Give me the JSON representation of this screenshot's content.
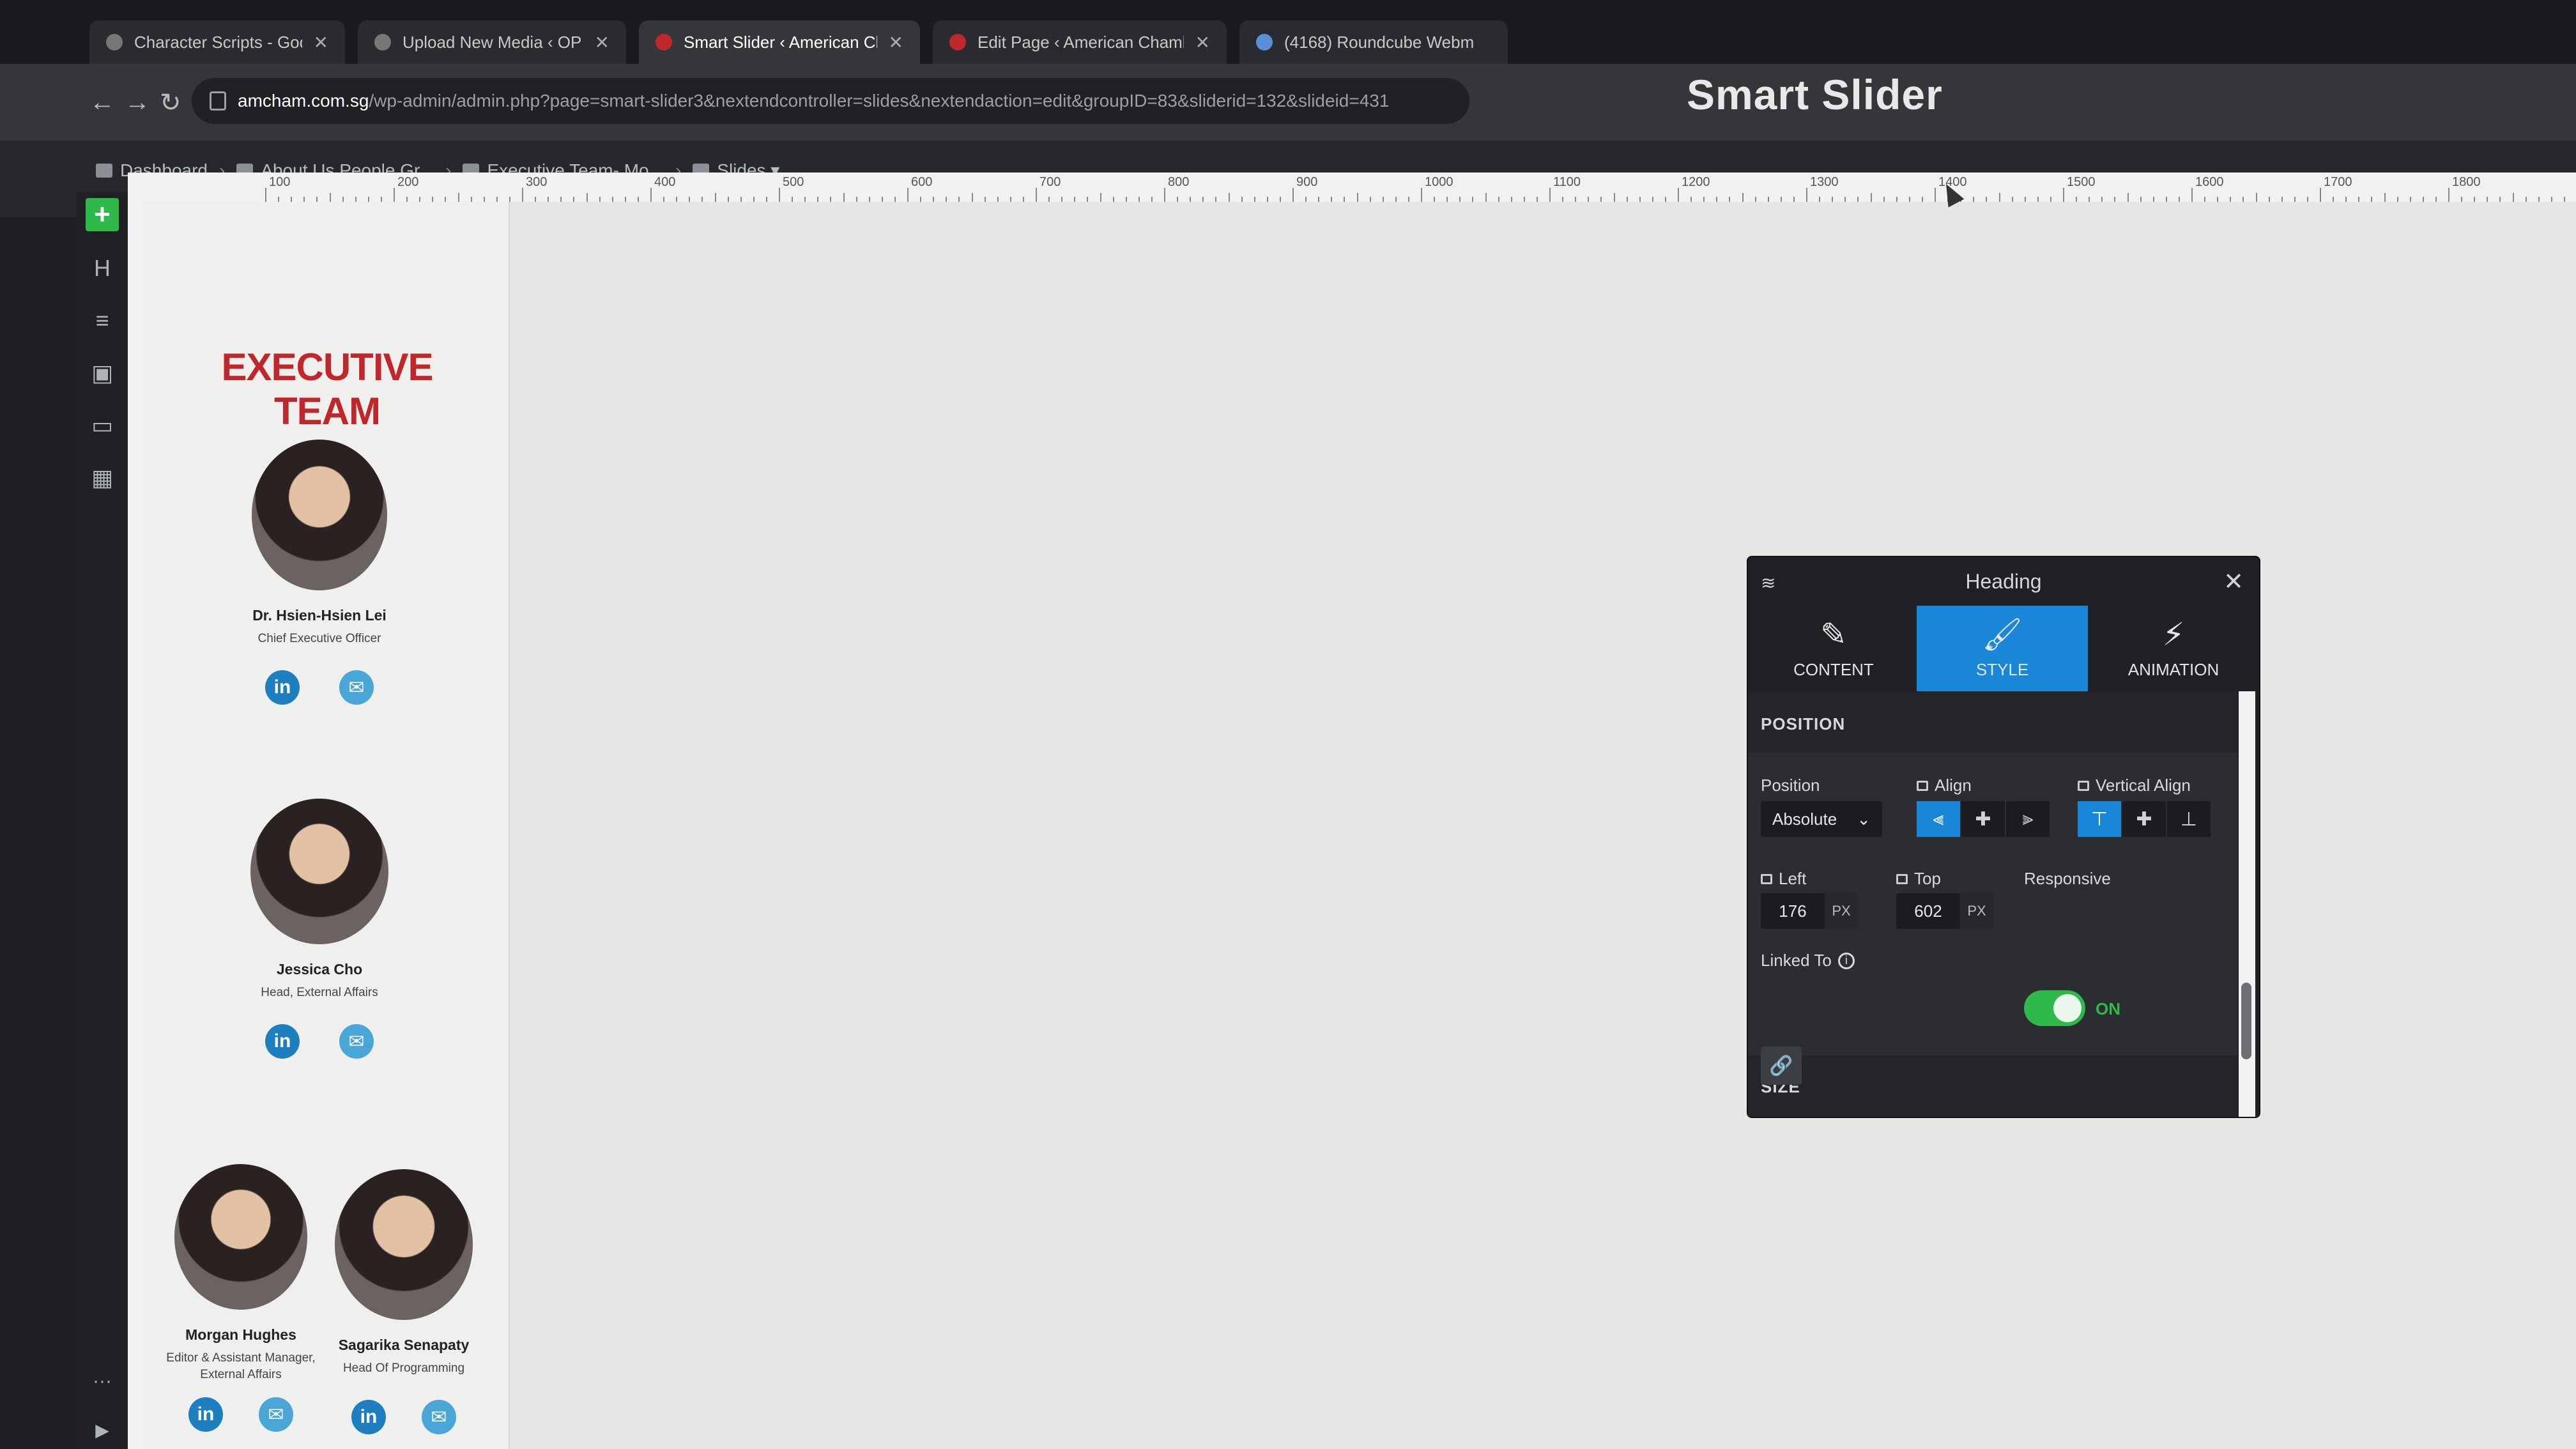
{
  "browser": {
    "tabs": [
      {
        "label": "Character Scripts - Google Dr",
        "active": false
      },
      {
        "label": "Upload New Media ‹ OP Demo",
        "active": false
      },
      {
        "label": "Smart Slider ‹ American Cham",
        "active": true
      },
      {
        "label": "Edit Page ‹ American Chamber",
        "active": false
      },
      {
        "label": "(4168) Roundcube Webm",
        "active": false
      }
    ],
    "close_glyph": "✕",
    "address": {
      "host": "amcham.com.sg",
      "path": "/wp-admin/admin.php?page=smart-slider3&nextendcontroller=slides&nextendaction=edit&groupID=83&sliderid=132&slideid=431"
    },
    "nav": {
      "back": "←",
      "forward": "→",
      "reload": "↻"
    }
  },
  "app": {
    "logo": "Smart Slider",
    "breadcrumb": [
      {
        "label": "Dashboard",
        "icon": "home-icon"
      },
      {
        "label": "About Us People Gr...",
        "icon": "folder-icon"
      },
      {
        "label": "Executive Team- Mo...",
        "icon": "image-icon"
      },
      {
        "label": "Slides ▾",
        "icon": "grid-icon"
      }
    ],
    "crumb_sep": "›",
    "rail": [
      {
        "name": "add-layer-button",
        "glyph": "+"
      },
      {
        "name": "heading-tool-icon",
        "glyph": "H"
      },
      {
        "name": "text-tool-icon",
        "glyph": "≡"
      },
      {
        "name": "image-tool-icon",
        "glyph": "▣"
      },
      {
        "name": "button-tool-icon",
        "glyph": "▭"
      },
      {
        "name": "structure-tool-icon",
        "glyph": "▦"
      }
    ],
    "rail_bottom": {
      "more": "···",
      "play": "▶"
    }
  },
  "ruler": {
    "labels": [
      "100",
      "200",
      "300",
      "400",
      "500",
      "600",
      "700",
      "800",
      "900",
      "1000",
      "1100",
      "1200",
      "1300",
      "1400",
      "1500",
      "1600",
      "1700",
      "1800"
    ]
  },
  "slide": {
    "title": "EXECUTIVE TEAM",
    "people": [
      {
        "name": "Dr. Hsien-Hsien Lei",
        "role": "Chief Executive Officer"
      },
      {
        "name": "Jessica Cho",
        "role": "Head, External Affairs"
      },
      {
        "name": "Morgan Hughes",
        "role": "Editor & Assistant Manager, External Affairs"
      },
      {
        "name": "Sagarika Senapaty",
        "role": "Head Of Programming"
      }
    ],
    "linkedin_glyph": "in",
    "mail_glyph": "✉"
  },
  "panel": {
    "title": "Heading",
    "close": "✕",
    "layers_glyph": "≋",
    "tabs": [
      {
        "label": "CONTENT",
        "icon": "✎",
        "active": false
      },
      {
        "label": "STYLE",
        "icon": "🖌",
        "active": true
      },
      {
        "label": "ANIMATION",
        "icon": "⚡",
        "active": false
      }
    ],
    "position_section": "POSITION",
    "position_label": "Position",
    "position_value": "Absolute",
    "align_label": "Align",
    "valign_label": "Vertical Align",
    "align_glyphs": [
      "⫷",
      "✚",
      "⫸"
    ],
    "valign_glyphs": [
      "⊤",
      "✚",
      "⊥"
    ],
    "left_label": "Left",
    "left_value": "176",
    "top_label": "Top",
    "top_value": "602",
    "unit": "PX",
    "responsive_label": "Responsive",
    "responsive_value": "ON",
    "linked_label": "Linked To",
    "info_glyph": "i",
    "link_glyph": "🔗",
    "size_section": "SIZE",
    "chevron": "⌄"
  }
}
